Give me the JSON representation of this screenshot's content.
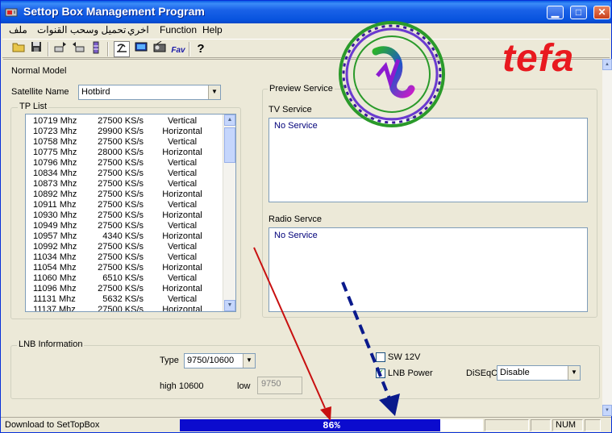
{
  "window": {
    "title": "Settop Box Management Program"
  },
  "menu": [
    "ملف",
    "تحميل وسحب القنوات",
    "اخري",
    "Function",
    "Help"
  ],
  "toolbar": {
    "icons": [
      "open-folder-icon",
      "save-icon",
      "upload-icon",
      "download-icon",
      "receiver-icon",
      "satellite-dish-icon",
      "tv-icon",
      "radio-icon",
      "fav-icon",
      "help-icon"
    ],
    "fav_label": "Fav"
  },
  "main": {
    "model": "Normal Model",
    "satellite_label": "Satellite Name",
    "satellite_value": "Hotbird",
    "tp_list_title": "TP List",
    "tp_list": [
      [
        "10719 Mhz",
        "27500 KS/s",
        "Vertical"
      ],
      [
        "10723 Mhz",
        "29900 KS/s",
        "Horizontal"
      ],
      [
        "10758 Mhz",
        "27500 KS/s",
        "Vertical"
      ],
      [
        "10775 Mhz",
        "28000 KS/s",
        "Horizontal"
      ],
      [
        "10796 Mhz",
        "27500 KS/s",
        "Vertical"
      ],
      [
        "10834 Mhz",
        "27500 KS/s",
        "Vertical"
      ],
      [
        "10873 Mhz",
        "27500 KS/s",
        "Vertical"
      ],
      [
        "10892 Mhz",
        "27500 KS/s",
        "Horizontal"
      ],
      [
        "10911 Mhz",
        "27500 KS/s",
        "Vertical"
      ],
      [
        "10930 Mhz",
        "27500 KS/s",
        "Horizontal"
      ],
      [
        "10949 Mhz",
        "27500 KS/s",
        "Vertical"
      ],
      [
        "10957 Mhz",
        "4340 KS/s",
        "Horizontal"
      ],
      [
        "10992 Mhz",
        "27500 KS/s",
        "Vertical"
      ],
      [
        "11034 Mhz",
        "27500 KS/s",
        "Vertical"
      ],
      [
        "11054 Mhz",
        "27500 KS/s",
        "Horizontal"
      ],
      [
        "11060 Mhz",
        "6510 KS/s",
        "Vertical"
      ],
      [
        "11096 Mhz",
        "27500 KS/s",
        "Horizontal"
      ],
      [
        "11131 Mhz",
        "5632 KS/s",
        "Vertical"
      ],
      [
        "11137 Mhz",
        "27500 KS/s",
        "Horizontal"
      ]
    ],
    "preview_title": "Preview Service",
    "tv_label": "TV Service",
    "tv_value": "No Service",
    "radio_label": "Radio Servce",
    "radio_value": "No Service"
  },
  "lnb": {
    "title": "LNB Information",
    "type_label": "Type",
    "type_value": "9750/10600",
    "high_label": "high 10600",
    "low_label": "low",
    "low_value": "9750",
    "sw12v_label": "SW 12V",
    "sw12v_checked": false,
    "lnb_power_label": "LNB Power",
    "lnb_power_checked": true,
    "diseqc_label": "DiSEqC",
    "diseqc_value": "Disable"
  },
  "status": {
    "text": "Download to SetTopBox",
    "progress_percent": 86,
    "progress_label": "86%",
    "num": "NUM"
  },
  "overlay": {
    "logo_text": "tefa",
    "stamp_text": "منتديات مصراوي سات",
    "colors": {
      "logo": "#e8191f",
      "red_arrow": "#c81010",
      "blue_arrow": "#0a1a8c",
      "progress": "#0b0bce"
    }
  }
}
